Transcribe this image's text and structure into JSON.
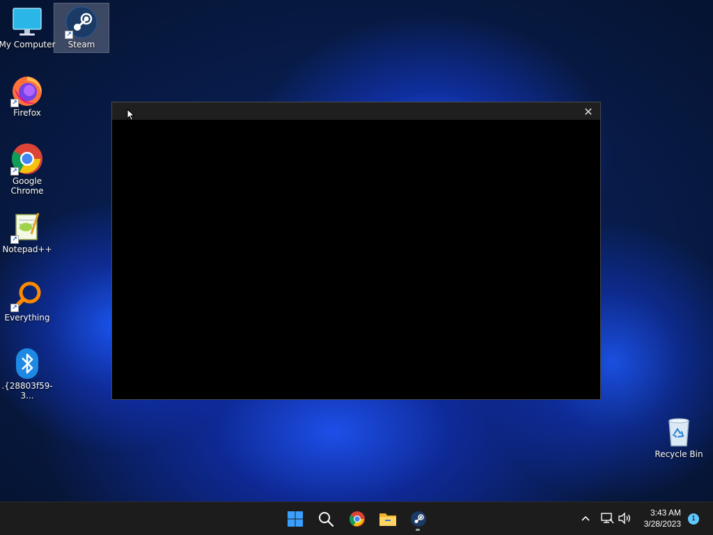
{
  "desktop": {
    "icons": [
      {
        "label": "My Computer",
        "icon": "monitor-icon"
      },
      {
        "label": "Steam",
        "icon": "steam-icon"
      },
      {
        "label": "Firefox",
        "icon": "firefox-icon"
      },
      {
        "label": "Google Chrome",
        "icon": "chrome-icon"
      },
      {
        "label": "Notepad++",
        "icon": "notepadpp-icon"
      },
      {
        "label": "Everything",
        "icon": "everything-icon"
      },
      {
        "label": ".{28803f59-3...",
        "icon": "bluetooth-icon"
      },
      {
        "label": "Recycle Bin",
        "icon": "recycle-bin-icon"
      }
    ],
    "selected_icon": "Steam"
  },
  "window": {
    "close_glyph": "✕"
  },
  "taskbar": {
    "apps": [
      "start-icon",
      "search-icon",
      "chrome-icon",
      "file-explorer-icon",
      "steam-icon"
    ],
    "tray": [
      "chevron-up-icon",
      "network-icon",
      "volume-icon"
    ],
    "clock": {
      "time": "3:43 AM",
      "date": "3/28/2023"
    },
    "notification_count": "1"
  },
  "colors": {
    "taskbar_bg": "#1c1c1c",
    "window_bg": "#000000",
    "accent": "#0078d4"
  }
}
